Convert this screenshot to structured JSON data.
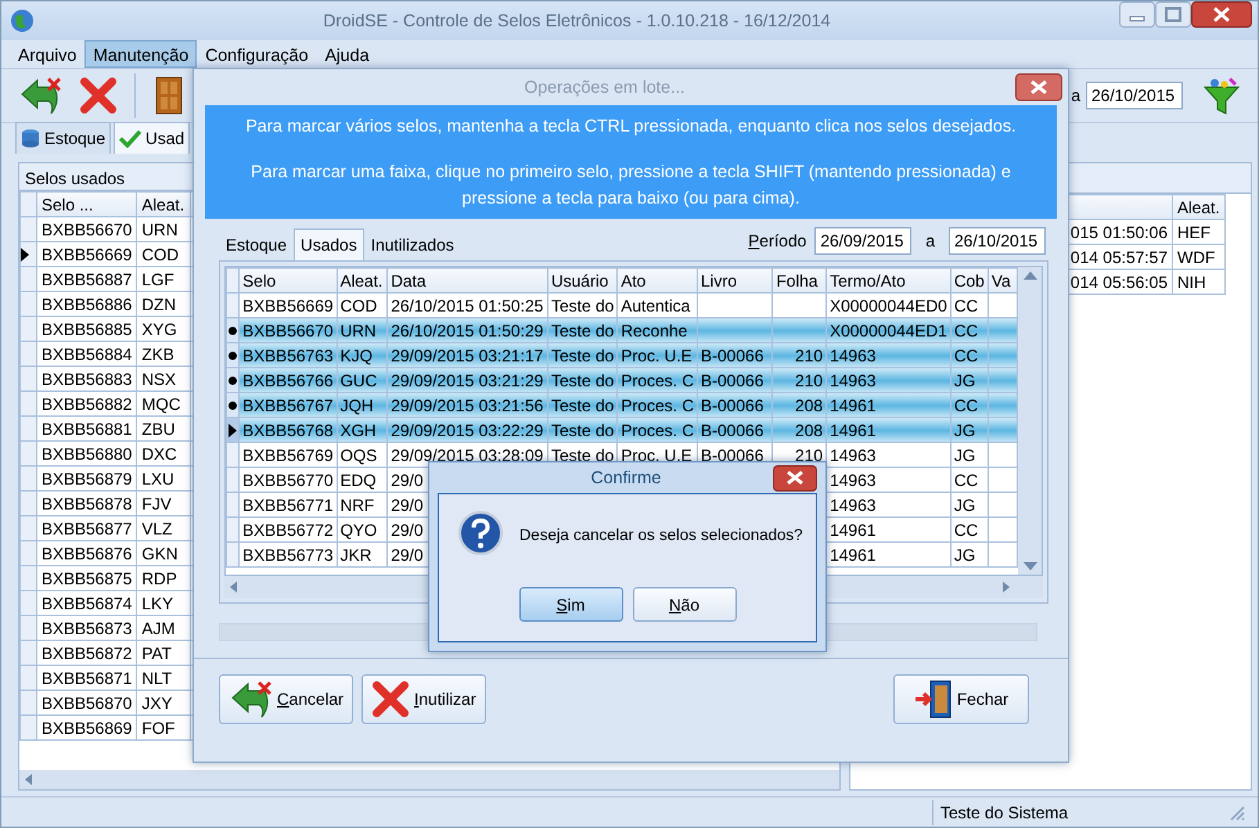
{
  "window": {
    "title": "DroidSE - Controle de Selos Eletrônicos - 1.0.10.218 - 16/12/2014"
  },
  "menu": [
    {
      "label": "Arquivo",
      "selected": false
    },
    {
      "label": "Manutenção",
      "selected": true
    },
    {
      "label": "Configuração",
      "selected": false
    },
    {
      "label": "Ajuda",
      "selected": false
    }
  ],
  "toolbar": {
    "date_label": "a",
    "date_value": "26/10/2015"
  },
  "tabs": [
    {
      "label": "Estoque",
      "kind": "stock",
      "selected": false
    },
    {
      "label": "Usad",
      "kind": "used",
      "selected": true
    }
  ],
  "panel_title": "Selos usados",
  "left_table": {
    "columns": [
      "Selo ...",
      "Aleat."
    ],
    "rows": [
      {
        "selo": "BXBB56670",
        "aleat": "URN",
        "current": false
      },
      {
        "selo": "BXBB56669",
        "aleat": "COD",
        "current": true
      },
      {
        "selo": "BXBB56887",
        "aleat": "LGF",
        "current": false
      },
      {
        "selo": "BXBB56886",
        "aleat": "DZN",
        "current": false
      },
      {
        "selo": "BXBB56885",
        "aleat": "XYG",
        "current": false
      },
      {
        "selo": "BXBB56884",
        "aleat": "ZKB",
        "current": false
      },
      {
        "selo": "BXBB56883",
        "aleat": "NSX",
        "current": false
      },
      {
        "selo": "BXBB56882",
        "aleat": "MQC",
        "current": false
      },
      {
        "selo": "BXBB56881",
        "aleat": "ZBU",
        "current": false
      },
      {
        "selo": "BXBB56880",
        "aleat": "DXC",
        "current": false
      },
      {
        "selo": "BXBB56879",
        "aleat": "LXU",
        "current": false
      },
      {
        "selo": "BXBB56878",
        "aleat": "FJV",
        "current": false
      },
      {
        "selo": "BXBB56877",
        "aleat": "VLZ",
        "current": false
      },
      {
        "selo": "BXBB56876",
        "aleat": "GKN",
        "current": false
      },
      {
        "selo": "BXBB56875",
        "aleat": "RDP",
        "current": false
      },
      {
        "selo": "BXBB56874",
        "aleat": "LKY",
        "current": false
      },
      {
        "selo": "BXBB56873",
        "aleat": "AJM",
        "current": false
      },
      {
        "selo": "BXBB56872",
        "aleat": "PAT",
        "current": false
      },
      {
        "selo": "BXBB56871",
        "aleat": "NLT",
        "current": false
      },
      {
        "selo": "BXBB56870",
        "aleat": "JXY",
        "current": false
      },
      {
        "selo": "BXBB56869",
        "aleat": "FOF",
        "current": false
      }
    ]
  },
  "right_table": {
    "columns": [
      "Aleat."
    ],
    "rows": [
      {
        "data": "015 01:50:06",
        "aleat": "HEF"
      },
      {
        "data": "014 05:57:57",
        "aleat": "WDF"
      },
      {
        "data": "014 05:56:05",
        "aleat": "NIH"
      }
    ]
  },
  "status_bar": "Teste do Sistema",
  "batch_dialog": {
    "title": "Operações em lote...",
    "info": [
      "Para marcar vários selos, mantenha a tecla CTRL pressionada, enquanto clica nos selos desejados.",
      "Para marcar uma faixa, clique no primeiro selo, pressione a tecla SHIFT (mantendo pressionada) e pressione a tecla para baixo (ou para cima)."
    ],
    "tabs": [
      {
        "label": "Estoque",
        "selected": false
      },
      {
        "label": "Usados",
        "selected": true
      },
      {
        "label": "Inutilizados",
        "selected": false
      }
    ],
    "period_label": "Período",
    "period_from": "26/09/2015",
    "period_to_label": "a",
    "period_to": "26/10/2015",
    "table": {
      "columns": [
        "Selo",
        "Aleat.",
        "Data",
        "Usuário",
        "Ato",
        "Livro",
        "Folha",
        "Termo/Ato",
        "Cob",
        "Va"
      ],
      "rows": [
        {
          "selo": "BXBB56669",
          "aleat": "COD",
          "data": "26/10/2015 01:50:25",
          "usuario": "Teste do",
          "ato": "Autentica",
          "termo": "X00000044ED0",
          "cob": "CC",
          "selected": false,
          "current": false
        },
        {
          "selo": "BXBB56670",
          "aleat": "URN",
          "data": "26/10/2015 01:50:29",
          "usuario": "Teste do",
          "ato": "Reconhe",
          "termo": "X00000044ED1",
          "cob": "CC",
          "selected": true,
          "current": false
        },
        {
          "selo": "BXBB56763",
          "aleat": "KJQ",
          "data": "29/09/2015 03:21:17",
          "usuario": "Teste do",
          "ato": "Proc. U.E",
          "livro": "B-00066",
          "folha": "210",
          "termo": "14963",
          "cob": "CC",
          "selected": true,
          "current": false
        },
        {
          "selo": "BXBB56766",
          "aleat": "GUC",
          "data": "29/09/2015 03:21:29",
          "usuario": "Teste do",
          "ato": "Proces. C",
          "livro": "B-00066",
          "folha": "210",
          "termo": "14963",
          "cob": "JG",
          "selected": true,
          "current": false
        },
        {
          "selo": "BXBB56767",
          "aleat": "JQH",
          "data": "29/09/2015 03:21:56",
          "usuario": "Teste do",
          "ato": "Proces. C",
          "livro": "B-00066",
          "folha": "208",
          "termo": "14961",
          "cob": "CC",
          "selected": true,
          "current": false
        },
        {
          "selo": "BXBB56768",
          "aleat": "XGH",
          "data": "29/09/2015 03:22:29",
          "usuario": "Teste do",
          "ato": "Proces. C",
          "livro": "B-00066",
          "folha": "208",
          "termo": "14961",
          "cob": "JG",
          "selected": true,
          "current": true
        },
        {
          "selo": "BXBB56769",
          "aleat": "OQS",
          "data": "29/09/2015 03:28:09",
          "usuario": "Teste do",
          "ato": "Proc. U.E",
          "livro": "B-00066",
          "folha": "210",
          "termo": "14963",
          "cob": "JG",
          "selected": false,
          "current": false
        },
        {
          "selo": "BXBB56770",
          "aleat": "EDQ",
          "data": "29/0",
          "termo": "14963",
          "cob": "CC",
          "selected": false,
          "current": false
        },
        {
          "selo": "BXBB56771",
          "aleat": "NRF",
          "data": "29/0",
          "termo": "14963",
          "cob": "JG",
          "selected": false,
          "current": false
        },
        {
          "selo": "BXBB56772",
          "aleat": "QYO",
          "data": "29/0",
          "termo": "14961",
          "cob": "CC",
          "selected": false,
          "current": false
        },
        {
          "selo": "BXBB56773",
          "aleat": "JKR",
          "data": "29/0",
          "termo": "14961",
          "cob": "JG",
          "selected": false,
          "current": false
        }
      ]
    },
    "progress": {
      "level": 0
    },
    "buttons": [
      {
        "label": "Cancelar",
        "kind": "cancel",
        "mnemonic": true
      },
      {
        "label": "Inutilizar",
        "kind": "discard",
        "mnemonic": true
      },
      {
        "label": "Fechar",
        "kind": "close",
        "mnemonic": false
      }
    ]
  },
  "confirm": {
    "title": "Confirme",
    "message": "Deseja cancelar os selos selecionados?",
    "buttons": [
      {
        "label": "Sim",
        "selected": true,
        "mnemonic": true
      },
      {
        "label": "Não",
        "selected": false,
        "mnemonic": true
      }
    ]
  }
}
